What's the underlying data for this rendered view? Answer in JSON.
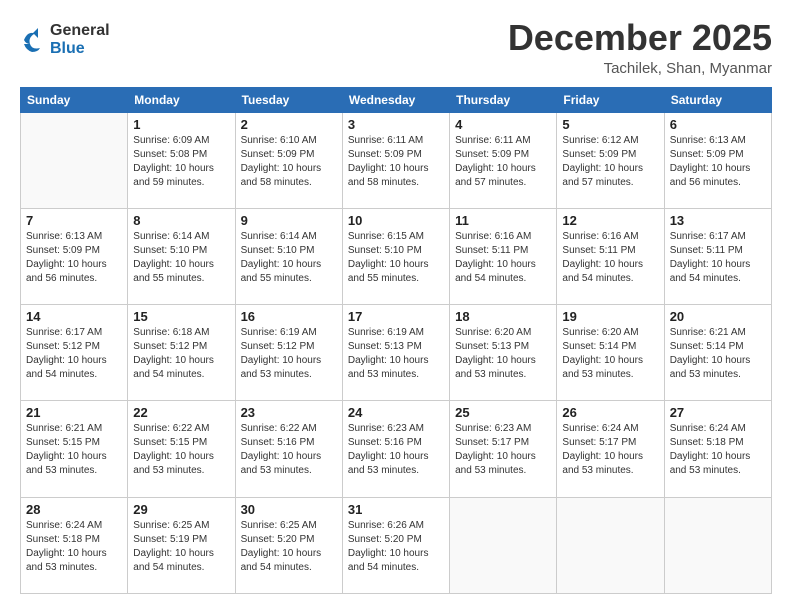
{
  "logo": {
    "line1": "General",
    "line2": "Blue"
  },
  "title": "December 2025",
  "subtitle": "Tachilek, Shan, Myanmar",
  "days_header": [
    "Sunday",
    "Monday",
    "Tuesday",
    "Wednesday",
    "Thursday",
    "Friday",
    "Saturday"
  ],
  "weeks": [
    [
      {
        "day": "",
        "info": ""
      },
      {
        "day": "1",
        "info": "Sunrise: 6:09 AM\nSunset: 5:08 PM\nDaylight: 10 hours\nand 59 minutes."
      },
      {
        "day": "2",
        "info": "Sunrise: 6:10 AM\nSunset: 5:09 PM\nDaylight: 10 hours\nand 58 minutes."
      },
      {
        "day": "3",
        "info": "Sunrise: 6:11 AM\nSunset: 5:09 PM\nDaylight: 10 hours\nand 58 minutes."
      },
      {
        "day": "4",
        "info": "Sunrise: 6:11 AM\nSunset: 5:09 PM\nDaylight: 10 hours\nand 57 minutes."
      },
      {
        "day": "5",
        "info": "Sunrise: 6:12 AM\nSunset: 5:09 PM\nDaylight: 10 hours\nand 57 minutes."
      },
      {
        "day": "6",
        "info": "Sunrise: 6:13 AM\nSunset: 5:09 PM\nDaylight: 10 hours\nand 56 minutes."
      }
    ],
    [
      {
        "day": "7",
        "info": "Sunrise: 6:13 AM\nSunset: 5:09 PM\nDaylight: 10 hours\nand 56 minutes."
      },
      {
        "day": "8",
        "info": "Sunrise: 6:14 AM\nSunset: 5:10 PM\nDaylight: 10 hours\nand 55 minutes."
      },
      {
        "day": "9",
        "info": "Sunrise: 6:14 AM\nSunset: 5:10 PM\nDaylight: 10 hours\nand 55 minutes."
      },
      {
        "day": "10",
        "info": "Sunrise: 6:15 AM\nSunset: 5:10 PM\nDaylight: 10 hours\nand 55 minutes."
      },
      {
        "day": "11",
        "info": "Sunrise: 6:16 AM\nSunset: 5:11 PM\nDaylight: 10 hours\nand 54 minutes."
      },
      {
        "day": "12",
        "info": "Sunrise: 6:16 AM\nSunset: 5:11 PM\nDaylight: 10 hours\nand 54 minutes."
      },
      {
        "day": "13",
        "info": "Sunrise: 6:17 AM\nSunset: 5:11 PM\nDaylight: 10 hours\nand 54 minutes."
      }
    ],
    [
      {
        "day": "14",
        "info": "Sunrise: 6:17 AM\nSunset: 5:12 PM\nDaylight: 10 hours\nand 54 minutes."
      },
      {
        "day": "15",
        "info": "Sunrise: 6:18 AM\nSunset: 5:12 PM\nDaylight: 10 hours\nand 54 minutes."
      },
      {
        "day": "16",
        "info": "Sunrise: 6:19 AM\nSunset: 5:12 PM\nDaylight: 10 hours\nand 53 minutes."
      },
      {
        "day": "17",
        "info": "Sunrise: 6:19 AM\nSunset: 5:13 PM\nDaylight: 10 hours\nand 53 minutes."
      },
      {
        "day": "18",
        "info": "Sunrise: 6:20 AM\nSunset: 5:13 PM\nDaylight: 10 hours\nand 53 minutes."
      },
      {
        "day": "19",
        "info": "Sunrise: 6:20 AM\nSunset: 5:14 PM\nDaylight: 10 hours\nand 53 minutes."
      },
      {
        "day": "20",
        "info": "Sunrise: 6:21 AM\nSunset: 5:14 PM\nDaylight: 10 hours\nand 53 minutes."
      }
    ],
    [
      {
        "day": "21",
        "info": "Sunrise: 6:21 AM\nSunset: 5:15 PM\nDaylight: 10 hours\nand 53 minutes."
      },
      {
        "day": "22",
        "info": "Sunrise: 6:22 AM\nSunset: 5:15 PM\nDaylight: 10 hours\nand 53 minutes."
      },
      {
        "day": "23",
        "info": "Sunrise: 6:22 AM\nSunset: 5:16 PM\nDaylight: 10 hours\nand 53 minutes."
      },
      {
        "day": "24",
        "info": "Sunrise: 6:23 AM\nSunset: 5:16 PM\nDaylight: 10 hours\nand 53 minutes."
      },
      {
        "day": "25",
        "info": "Sunrise: 6:23 AM\nSunset: 5:17 PM\nDaylight: 10 hours\nand 53 minutes."
      },
      {
        "day": "26",
        "info": "Sunrise: 6:24 AM\nSunset: 5:17 PM\nDaylight: 10 hours\nand 53 minutes."
      },
      {
        "day": "27",
        "info": "Sunrise: 6:24 AM\nSunset: 5:18 PM\nDaylight: 10 hours\nand 53 minutes."
      }
    ],
    [
      {
        "day": "28",
        "info": "Sunrise: 6:24 AM\nSunset: 5:18 PM\nDaylight: 10 hours\nand 53 minutes."
      },
      {
        "day": "29",
        "info": "Sunrise: 6:25 AM\nSunset: 5:19 PM\nDaylight: 10 hours\nand 54 minutes."
      },
      {
        "day": "30",
        "info": "Sunrise: 6:25 AM\nSunset: 5:20 PM\nDaylight: 10 hours\nand 54 minutes."
      },
      {
        "day": "31",
        "info": "Sunrise: 6:26 AM\nSunset: 5:20 PM\nDaylight: 10 hours\nand 54 minutes."
      },
      {
        "day": "",
        "info": ""
      },
      {
        "day": "",
        "info": ""
      },
      {
        "day": "",
        "info": ""
      }
    ]
  ]
}
